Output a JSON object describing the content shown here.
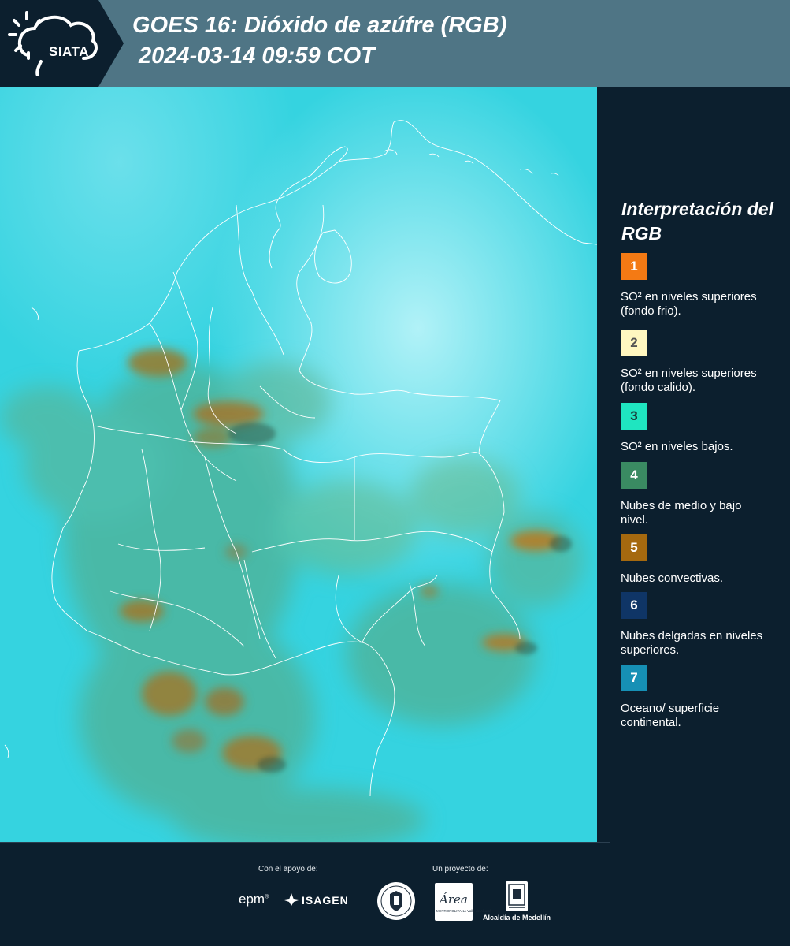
{
  "header": {
    "logo_text": "SIATA",
    "title_line1": "GOES 16: Dióxido de azúfre (RGB)",
    "title_line2": "2024-03-14 09:59 COT",
    "bar_color": "#4f7585",
    "dark_color": "#0c1f2e"
  },
  "legend": {
    "title": "Interpretación del RGB",
    "items": [
      {
        "number": "1",
        "description": "SO² en niveles superiores (fondo frio).",
        "color": "#f47a14",
        "text_color": "#ffffff"
      },
      {
        "number": "2",
        "description": "SO² en niveles superiores (fondo calido).",
        "color": "#fff7c0",
        "text_color": "#555555"
      },
      {
        "number": "3",
        "description": "SO² en niveles bajos.",
        "color": "#1fe5c0",
        "text_color": "#1a3a3a"
      },
      {
        "number": "4",
        "description": "Nubes de medio y bajo nivel.",
        "color": "#3a8a62",
        "text_color": "#ffffff"
      },
      {
        "number": "5",
        "description": "Nubes convectivas.",
        "color": "#a5690f",
        "text_color": "#ffffff"
      },
      {
        "number": "6",
        "description": "Nubes delgadas en niveles superiores.",
        "color": "#0f3566",
        "text_color": "#ffffff"
      },
      {
        "number": "7",
        "description": "Oceano/ superficie continental.",
        "color": "#1690b5",
        "text_color": "#ffffff"
      }
    ]
  },
  "map": {
    "background_color": "#35d3e0",
    "border_color": "#ffffff"
  },
  "footer": {
    "support_label": "Con el apoyo de:",
    "project_label": "Un proyecto de:",
    "epm": "epm",
    "epm_mark": "®",
    "isagen": "ISAGEN",
    "area_logo": "Área",
    "area_sub": "METROPOLITANA Valle de Aburrá",
    "alcaldia": "Alcaldía de Medellín"
  }
}
